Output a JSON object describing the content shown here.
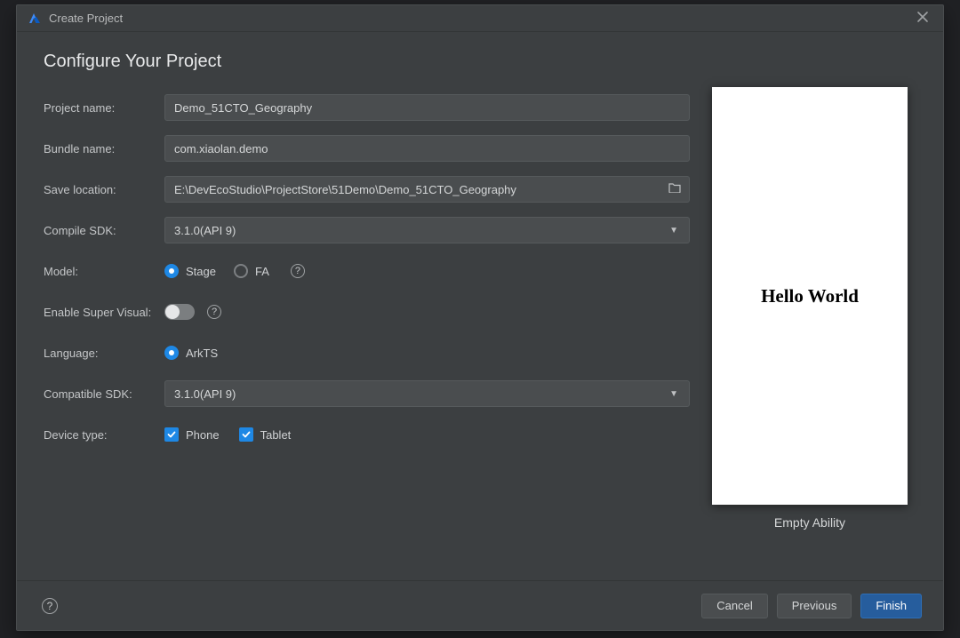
{
  "window": {
    "title": "Create Project"
  },
  "heading": "Configure Your Project",
  "labels": {
    "project_name": "Project name:",
    "bundle_name": "Bundle name:",
    "save_location": "Save location:",
    "compile_sdk": "Compile SDK:",
    "model": "Model:",
    "enable_super_visual": "Enable Super Visual:",
    "language": "Language:",
    "compatible_sdk": "Compatible SDK:",
    "device_type": "Device type:"
  },
  "values": {
    "project_name": "Demo_51CTO_Geography",
    "bundle_name": "com.xiaolan.demo",
    "save_location": "E:\\DevEcoStudio\\ProjectStore\\51Demo\\Demo_51CTO_Geography",
    "compile_sdk": "3.1.0(API 9)",
    "compatible_sdk": "3.1.0(API 9)"
  },
  "model": {
    "options": [
      {
        "label": "Stage",
        "selected": true
      },
      {
        "label": "FA",
        "selected": false
      }
    ]
  },
  "enable_super_visual": {
    "on": false
  },
  "language": {
    "options": [
      {
        "label": "ArkTS",
        "selected": true
      }
    ]
  },
  "device_type": {
    "options": [
      {
        "label": "Phone",
        "checked": true
      },
      {
        "label": "Tablet",
        "checked": true
      }
    ]
  },
  "preview": {
    "text": "Hello World",
    "caption": "Empty Ability"
  },
  "footer": {
    "cancel": "Cancel",
    "previous": "Previous",
    "finish": "Finish"
  }
}
